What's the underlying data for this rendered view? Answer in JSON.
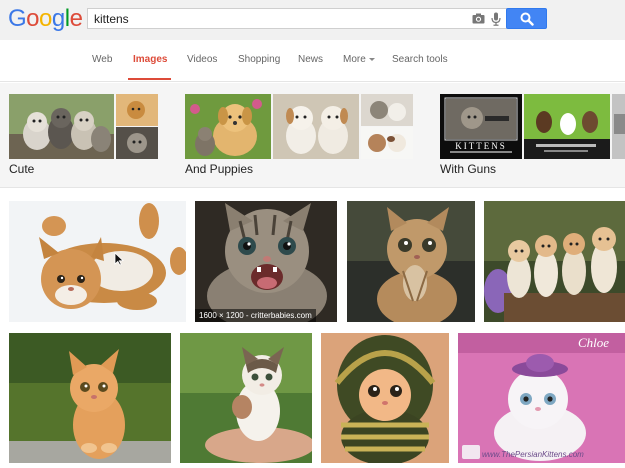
{
  "header": {
    "logo_letters": [
      "G",
      "o",
      "o",
      "g",
      "l",
      "e"
    ],
    "logo_colors": [
      "#3b78e7",
      "#dd4b39",
      "#f4b400",
      "#3b78e7",
      "#009925",
      "#dd4b39"
    ],
    "search_value": "kittens",
    "camera_icon": "camera-icon",
    "mic_icon": "mic-icon",
    "search_icon": "search-icon",
    "accent": "#4285f4"
  },
  "nav": {
    "tabs": [
      {
        "label": "Web"
      },
      {
        "label": "Images",
        "active": true
      },
      {
        "label": "Videos"
      },
      {
        "label": "Shopping"
      },
      {
        "label": "News"
      },
      {
        "label": "More"
      },
      {
        "label": "Search tools"
      }
    ],
    "active_color": "#dd4b39"
  },
  "related": [
    {
      "label": "Cute"
    },
    {
      "label": "And Puppies"
    },
    {
      "label": "With Guns",
      "poster_text": "KITTENS"
    }
  ],
  "results": {
    "row1": [
      {
        "alt": "kitten lying on back"
      },
      {
        "alt": "tabby kitten meowing",
        "caption": "1600 × 1200 - critterbabies.com"
      },
      {
        "alt": "kitten praying"
      },
      {
        "alt": "four kittens on log"
      }
    ],
    "row2": [
      {
        "alt": "orange kitten on grass"
      },
      {
        "alt": "kitten held in hand"
      },
      {
        "alt": "kitten in knitted hood"
      },
      {
        "alt": "white persian kitten with hat",
        "signature": "Chloe",
        "watermark": "www.ThePersianKittens.com"
      }
    ]
  }
}
